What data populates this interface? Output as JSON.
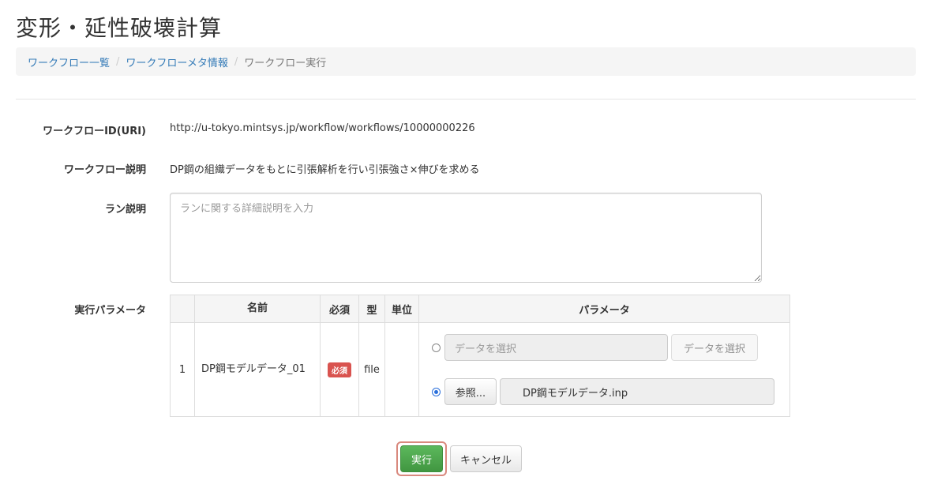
{
  "page": {
    "title": "変形・延性破壊計算"
  },
  "breadcrumb": [
    {
      "label": "ワークフロー一覧"
    },
    {
      "label": "ワークフローメタ情報"
    },
    {
      "label": "ワークフロー実行"
    }
  ],
  "form": {
    "workflow_id_label": "ワークフローID(URI)",
    "workflow_id_value": "http://u-tokyo.mintsys.jp/workflow/workflows/10000000226",
    "workflow_desc_label": "ワークフロー説明",
    "workflow_desc_value": "DP鋼の組織データをもとに引張解析を行い引張強さ×伸びを求める",
    "run_desc_label": "ラン説明",
    "run_desc_placeholder": "ランに関する詳細説明を入力",
    "params_label": "実行パラメータ"
  },
  "params_table": {
    "headers": {
      "name": "名前",
      "required": "必須",
      "type": "型",
      "unit": "単位",
      "parameter": "パラメータ"
    },
    "rows": [
      {
        "num": "1",
        "name": "DP鋼モデルデータ_01",
        "required_badge": "必須",
        "type": "file",
        "unit": "",
        "data_select_placeholder": "データを選択",
        "data_select_button": "データを選択",
        "browse_button": "参照...",
        "file_name": "DP鋼モデルデータ.inp"
      }
    ]
  },
  "actions": {
    "run_label": "実行",
    "cancel_label": "キャンセル"
  }
}
